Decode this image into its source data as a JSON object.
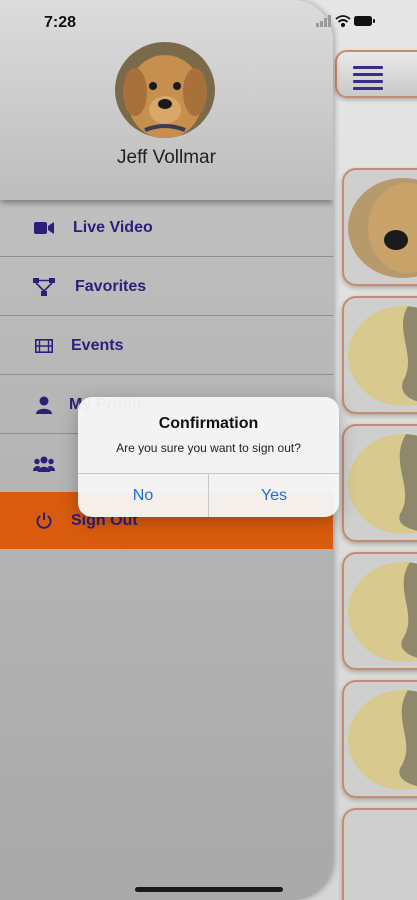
{
  "status_bar": {
    "time": "7:28",
    "icons": [
      "signal-icon",
      "wifi-icon",
      "battery-icon"
    ]
  },
  "drawer": {
    "user_name": "Jeff Vollmar",
    "items": [
      {
        "label": "Live Video",
        "icon": "video-camera-icon"
      },
      {
        "label": "Favorites",
        "icon": "network-icon"
      },
      {
        "label": "Events",
        "icon": "film-icon"
      },
      {
        "label": "My Profile",
        "icon": "user-icon"
      },
      {
        "label": "",
        "icon": "users-icon"
      },
      {
        "label": "Sign Out",
        "icon": "power-icon",
        "active": true
      }
    ]
  },
  "dialog": {
    "title": "Confirmation",
    "message": "Are you sure you want to sign out?",
    "no_label": "No",
    "yes_label": "Yes"
  },
  "colors": {
    "accent": "#d95b0d",
    "menu_text": "#2d1e7a",
    "link": "#1a6fe0",
    "border": "#c98b6c"
  }
}
